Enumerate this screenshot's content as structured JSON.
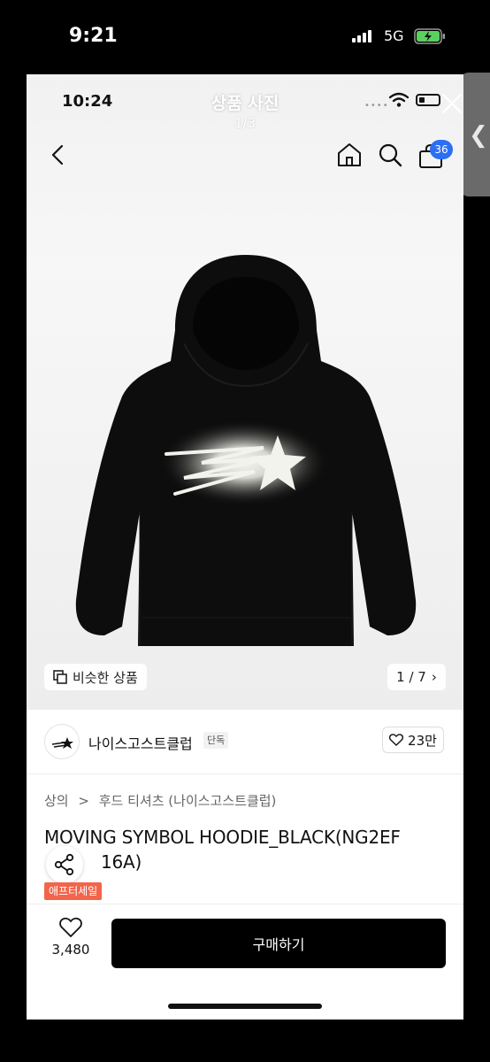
{
  "outer_status": {
    "time": "9:21",
    "network": "5G"
  },
  "inner_status": {
    "time": "10:24"
  },
  "viewer": {
    "title": "상품 사진",
    "counter": "1/3"
  },
  "nav": {
    "cart_count": "36"
  },
  "similar": {
    "label": "비슷한 상품"
  },
  "pager": {
    "text": "1 / 7",
    "arrow": "›"
  },
  "brand": {
    "name": "나이스고스트클럽",
    "tag": "단독",
    "likes": "23만"
  },
  "breadcrumb": {
    "category": "상의",
    "separator": ">",
    "subcategory": "후드 티셔츠 (나이스고스트클럽)"
  },
  "product": {
    "name": "MOVING SYMBOL HOODIE_BLACK(NG2EF",
    "name_line2": "16A)",
    "sale_badge": "애프터세일"
  },
  "bottom": {
    "like_count": "3,480",
    "buy_label": "구매하기"
  },
  "colors": {
    "accent": "#2b6ff2",
    "sale": "#f2654b",
    "buy": "#000000"
  },
  "icons": [
    "back-icon",
    "home-icon",
    "search-icon",
    "bag-icon",
    "close-icon",
    "similar-icon",
    "heart-icon",
    "share-icon",
    "wifi-icon",
    "battery-icon",
    "signal-icon"
  ]
}
